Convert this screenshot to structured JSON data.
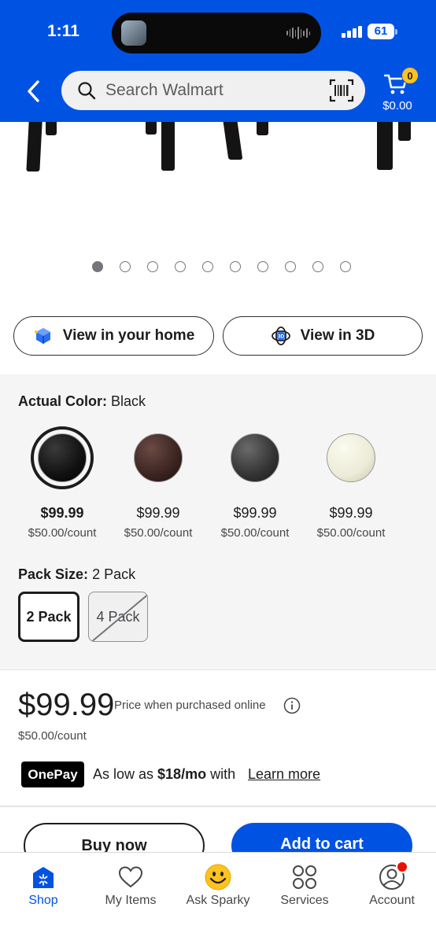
{
  "status_bar": {
    "time": "1:11",
    "battery": "61"
  },
  "header": {
    "search_placeholder": "Search Walmart",
    "cart_count": "0",
    "cart_total": "$0.00"
  },
  "gallery": {
    "dot_count": 10,
    "active_index": 0
  },
  "view_buttons": {
    "home": "View in your home",
    "three_d": "View in 3D"
  },
  "color": {
    "label": "Actual Color:",
    "value": "Black",
    "options": [
      {
        "price": "$99.99",
        "unit": "$50.00/count",
        "color": "#111111",
        "selected": true
      },
      {
        "price": "$99.99",
        "unit": "$50.00/count",
        "color": "#3b2420",
        "selected": false
      },
      {
        "price": "$99.99",
        "unit": "$50.00/count",
        "color": "#333333",
        "selected": false
      },
      {
        "price": "$99.99",
        "unit": "$50.00/count",
        "color": "#ecebd8",
        "selected": false
      }
    ]
  },
  "pack": {
    "label": "Pack Size:",
    "value": "2 Pack",
    "options": [
      "2 Pack",
      "4 Pack"
    ]
  },
  "price": {
    "main": "$99.99",
    "note": "Price when purchased online",
    "unit": "$50.00/count"
  },
  "onepay": {
    "logo": "OnePay",
    "prefix": "As low as ",
    "amount": "$18/mo",
    "suffix": " with",
    "link": "Learn more"
  },
  "actions": {
    "buy_now": "Buy now",
    "add_to_cart": "Add to cart"
  },
  "tabs": [
    {
      "label": "Shop",
      "icon": "shop-icon"
    },
    {
      "label": "My Items",
      "icon": "heart-icon"
    },
    {
      "label": "Ask Sparky",
      "icon": "sparky-icon"
    },
    {
      "label": "Services",
      "icon": "services-icon"
    },
    {
      "label": "Account",
      "icon": "account-icon"
    }
  ],
  "colors": {
    "brand_blue": "#0053e2",
    "spark_yellow": "#ffc220",
    "alert_red": "#ea1100"
  }
}
